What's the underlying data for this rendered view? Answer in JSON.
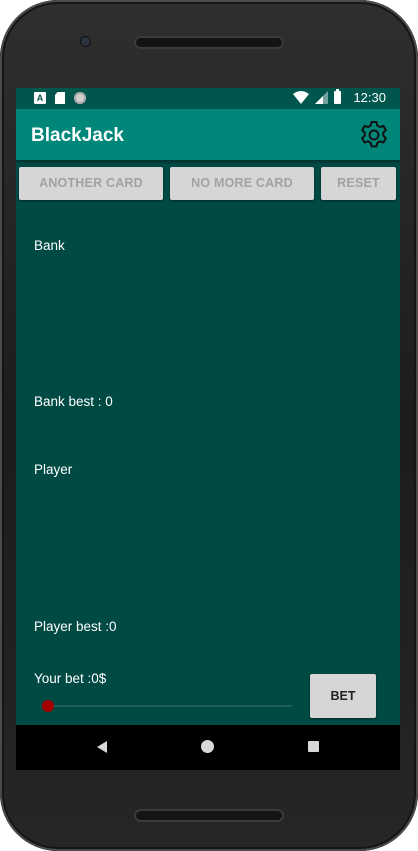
{
  "status_bar": {
    "time": "12:30",
    "left_icons": [
      "keyboard-a-icon",
      "sd-card-icon",
      "sync-circle-icon"
    ],
    "right_icons": [
      "wifi-icon",
      "signal-icon",
      "battery-icon"
    ]
  },
  "app_bar": {
    "title": "BlackJack",
    "settings_icon": "gear-icon",
    "color": "#00877a"
  },
  "buttons": {
    "another_card": "ANOTHER CARD",
    "no_more_card": "NO MORE CARD",
    "reset": "RESET",
    "bet": "BET"
  },
  "bank": {
    "label": "Bank",
    "best": "Bank best : 0"
  },
  "player": {
    "label": "Player",
    "best": "Player best :0"
  },
  "bet": {
    "label": "Your bet :0$",
    "slider_value": 0
  },
  "nav": {
    "icons": [
      "back-icon",
      "home-icon",
      "recents-icon"
    ]
  },
  "colors": {
    "background": "#004a44",
    "status_bar": "#00564d",
    "slider_thumb": "#a40000",
    "button_bg": "#d6d6d6"
  }
}
